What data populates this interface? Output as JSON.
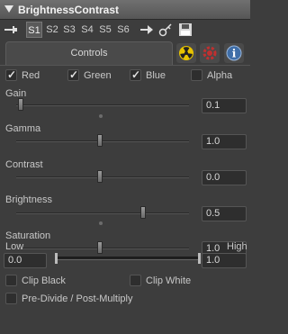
{
  "window": {
    "title": "BrightnessContrast"
  },
  "toolbar": {
    "slots": [
      "S1",
      "S2",
      "S3",
      "S4",
      "S5",
      "S6"
    ],
    "active_slot": "S1"
  },
  "tabs": {
    "controls_label": "Controls"
  },
  "channels": [
    {
      "label": "Red",
      "checked": true
    },
    {
      "label": "Green",
      "checked": true
    },
    {
      "label": "Blue",
      "checked": true
    },
    {
      "label": "Alpha",
      "checked": false
    }
  ],
  "sliders": [
    {
      "label": "Gain",
      "value": "0.1",
      "fill": 0.0
    },
    {
      "label": "Gamma",
      "value": "1.0",
      "fill": 0.5
    },
    {
      "label": "Contrast",
      "value": "0.0",
      "fill": 0.5
    },
    {
      "label": "Brightness",
      "value": "0.5",
      "fill": 0.75
    },
    {
      "label": "Saturation",
      "value": "1.0",
      "fill": 0.5
    }
  ],
  "range": {
    "low_label": "Low",
    "high_label": "High",
    "low_value": "0.0",
    "high_value": "1.0"
  },
  "options": [
    {
      "label": "Clip Black",
      "checked": false
    },
    {
      "label": "Clip White",
      "checked": false
    },
    {
      "label": "Pre-Divide / Post-Multiply",
      "checked": false
    }
  ]
}
